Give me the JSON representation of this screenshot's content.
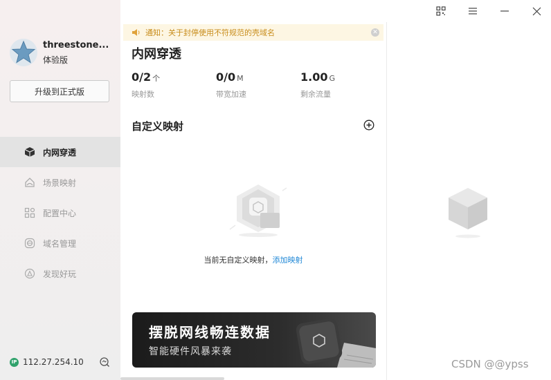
{
  "user": {
    "name": "threestone...",
    "plan": "体验版",
    "upgrade_label": "升级到正式版"
  },
  "nav": {
    "items": [
      {
        "label": "内网穿透",
        "icon": "cube-icon",
        "active": true
      },
      {
        "label": "场景映射",
        "icon": "scene-icon",
        "active": false
      },
      {
        "label": "配置中心",
        "icon": "config-grid-icon",
        "active": false
      },
      {
        "label": "域名管理",
        "icon": "domain-icon",
        "active": false
      },
      {
        "label": "发现好玩",
        "icon": "discover-icon",
        "active": false
      }
    ]
  },
  "status": {
    "ip_badge": "IP",
    "ip": "112.27.254.10"
  },
  "notice": {
    "text": "通知：关于封停使用不符规范的壳域名"
  },
  "main": {
    "title": "内网穿透",
    "stats": [
      {
        "value": "0/2",
        "unit": "个",
        "label": "映射数"
      },
      {
        "value": "0/0",
        "unit": "M",
        "label": "带宽加速"
      },
      {
        "value": "1.00",
        "unit": "G",
        "label": "剩余流量"
      }
    ],
    "section_title": "自定义映射",
    "empty_text": "当前无自定义映射，",
    "empty_link": "添加映射"
  },
  "banner": {
    "title": "摆脱网线畅连数据",
    "subtitle": "智能硬件风暴来袭"
  },
  "watermark": "CSDN @@ypss",
  "colors": {
    "accent_link": "#1f87d6",
    "notice_text": "#c88c1a",
    "notice_bg": "#fdf6e3",
    "ip_badge": "#2fa26b"
  }
}
